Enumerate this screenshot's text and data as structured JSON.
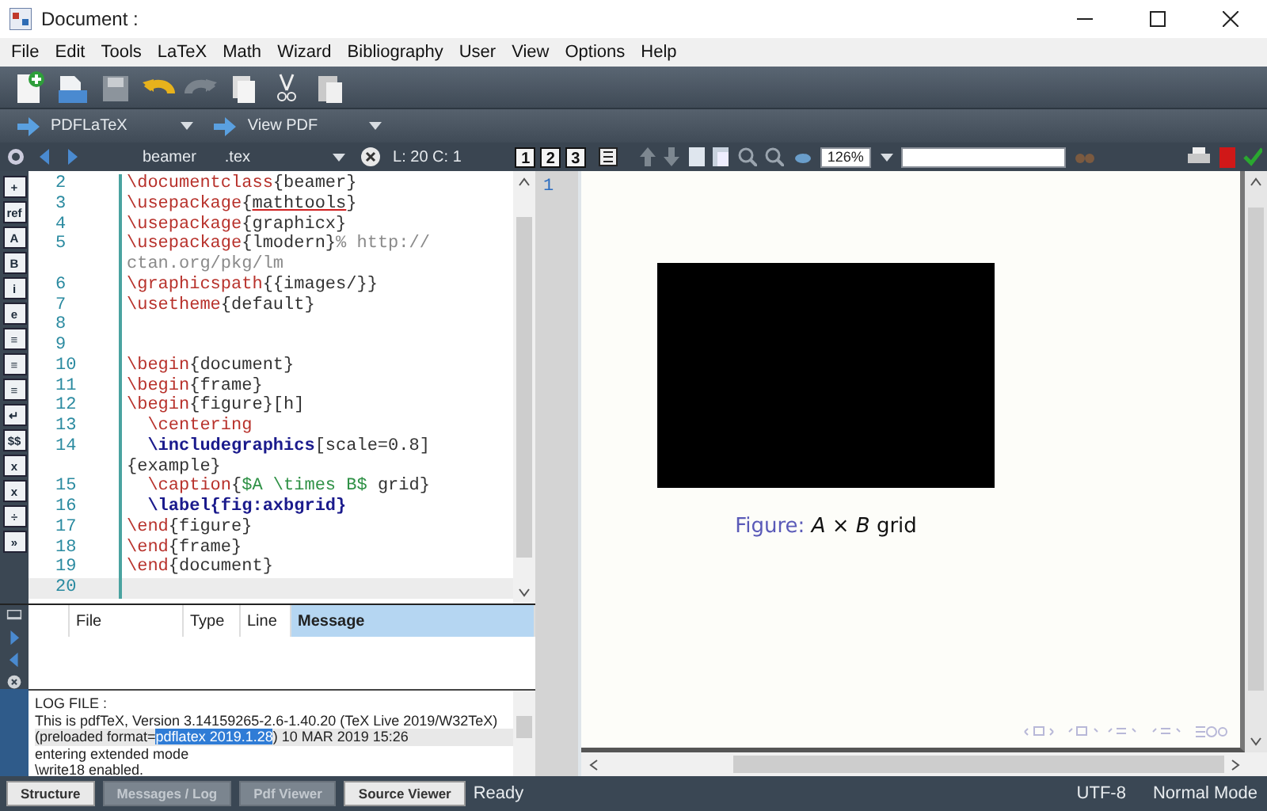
{
  "window": {
    "title": "Document :"
  },
  "menu": [
    "File",
    "Edit",
    "Tools",
    "LaTeX",
    "Math",
    "Wizard",
    "Bibliography",
    "User",
    "View",
    "Options",
    "Help"
  ],
  "build": {
    "compile": "PDFLaTeX",
    "view": "View PDF"
  },
  "editor_bar": {
    "file": "beamer",
    "ext": ".tex",
    "position": "L: 20 C: 1",
    "layouts": [
      "1",
      "2",
      "3"
    ]
  },
  "pdf_bar": {
    "zoom": "126%"
  },
  "side_tools": [
    "+",
    "ref",
    "A",
    "B",
    "i",
    "e",
    "≡",
    "≡",
    "≡",
    "↵",
    "$$",
    "x",
    "x",
    "÷",
    "»"
  ],
  "code": [
    {
      "number": "2",
      "current": false,
      "segments": [
        {
          "kind": "cmd",
          "text": "\\documentclass"
        },
        {
          "kind": "arg",
          "text": "{beamer}"
        }
      ]
    },
    {
      "number": "3",
      "current": false,
      "segments": [
        {
          "kind": "cmd",
          "text": "\\usepackage"
        },
        {
          "kind": "arg",
          "text": "{"
        },
        {
          "kind": "misspelled",
          "text": "mathtools"
        },
        {
          "kind": "arg",
          "text": "}"
        }
      ]
    },
    {
      "number": "4",
      "current": false,
      "segments": [
        {
          "kind": "cmd",
          "text": "\\usepackage"
        },
        {
          "kind": "arg",
          "text": "{graphicx}"
        }
      ]
    },
    {
      "number": "5",
      "current": false,
      "segments": [
        {
          "kind": "cmd",
          "text": "\\usepackage"
        },
        {
          "kind": "arg",
          "text": "{lmodern}"
        },
        {
          "kind": "comment",
          "text": "% http://"
        }
      ]
    },
    {
      "current": false,
      "segments": [
        {
          "kind": "comment",
          "text": "ctan.org/pkg/lm"
        }
      ]
    },
    {
      "number": "6",
      "current": false,
      "segments": [
        {
          "kind": "cmd",
          "text": "\\graphicspath"
        },
        {
          "kind": "arg",
          "text": "{{images/}}"
        }
      ]
    },
    {
      "number": "7",
      "current": false,
      "segments": [
        {
          "kind": "cmd",
          "text": "\\usetheme"
        },
        {
          "kind": "arg",
          "text": "{default}"
        }
      ]
    },
    {
      "number": "8",
      "current": false
    },
    {
      "number": "9",
      "current": false
    },
    {
      "number": "10",
      "current": false,
      "segments": [
        {
          "kind": "cmd",
          "text": "\\begin"
        },
        {
          "kind": "arg",
          "text": "{document}"
        }
      ]
    },
    {
      "number": "11",
      "current": false,
      "segments": [
        {
          "kind": "cmd",
          "text": "\\begin"
        },
        {
          "kind": "arg",
          "text": "{frame}"
        }
      ]
    },
    {
      "number": "12",
      "current": false,
      "segments": [
        {
          "kind": "cmd",
          "text": "\\begin"
        },
        {
          "kind": "arg",
          "text": "{figure}[h]"
        }
      ]
    },
    {
      "number": "13",
      "current": false,
      "segments": [
        {
          "kind": "cmd",
          "text": "  \\centering"
        }
      ]
    },
    {
      "number": "14",
      "current": false,
      "segments": [
        {
          "kind": "keyword",
          "text": "  \\includegraphics"
        },
        {
          "kind": "arg",
          "text": "[scale=0.8]"
        }
      ]
    },
    {
      "current": false,
      "segments": [
        {
          "kind": "arg",
          "text": "{example}"
        }
      ]
    },
    {
      "number": "15",
      "current": false,
      "segments": [
        {
          "kind": "cmd",
          "text": "  \\caption"
        },
        {
          "kind": "arg",
          "text": "{"
        },
        {
          "kind": "math",
          "text": "$A \\times B$"
        },
        {
          "kind": "arg",
          "text": " grid}"
        }
      ]
    },
    {
      "number": "16",
      "current": false,
      "segments": [
        {
          "kind": "keyword",
          "text": "  \\label{fig:axbgrid}"
        }
      ]
    },
    {
      "number": "17",
      "current": false,
      "segments": [
        {
          "kind": "cmd",
          "text": "\\end"
        },
        {
          "kind": "arg",
          "text": "{figure}"
        }
      ]
    },
    {
      "number": "18",
      "current": false,
      "segments": [
        {
          "kind": "cmd",
          "text": "\\end"
        },
        {
          "kind": "arg",
          "text": "{frame}"
        }
      ]
    },
    {
      "number": "19",
      "current": false,
      "segments": [
        {
          "kind": "cmd",
          "text": "\\end"
        },
        {
          "kind": "arg",
          "text": "{document}"
        }
      ]
    },
    {
      "number": "20",
      "current": true
    }
  ],
  "messages": {
    "columns": [
      {
        "label": "File",
        "selected": false
      },
      {
        "label": "Type",
        "selected": false
      },
      {
        "label": "Line",
        "selected": false
      },
      {
        "label": "Message",
        "selected": true
      }
    ]
  },
  "log": [
    {
      "current": false,
      "parts": [
        {
          "text": "LOG FILE :",
          "selected": false
        }
      ]
    },
    {
      "current": false,
      "parts": [
        {
          "text": "This is pdfTeX, Version 3.14159265-2.6-1.40.20 (TeX Live 2019/W32TeX)",
          "selected": false
        }
      ]
    },
    {
      "current": true,
      "parts": [
        {
          "text": "(preloaded format=",
          "selected": false
        },
        {
          "text": "pdflatex 2019.1.28",
          "selected": true
        },
        {
          "text": ") 10 MAR 2019 15:26",
          "selected": false
        }
      ]
    },
    {
      "current": false,
      "parts": [
        {
          "text": "entering extended mode",
          "selected": false
        }
      ]
    },
    {
      "current": false,
      "parts": [
        {
          "text": "\\write18 enabled.",
          "selected": false
        }
      ]
    }
  ],
  "pdf": {
    "line": "1",
    "caption_label": "Figure:",
    "caption": "*A* × *B* grid"
  },
  "status": {
    "tabs": [
      {
        "label": "Structure",
        "selected": false
      },
      {
        "label": "Messages / Log",
        "selected": true
      },
      {
        "label": "Pdf Viewer",
        "selected": true
      },
      {
        "label": "Source Viewer",
        "selected": false
      }
    ],
    "message": "Ready",
    "encoding": "UTF-8",
    "mode": "Normal Mode"
  }
}
